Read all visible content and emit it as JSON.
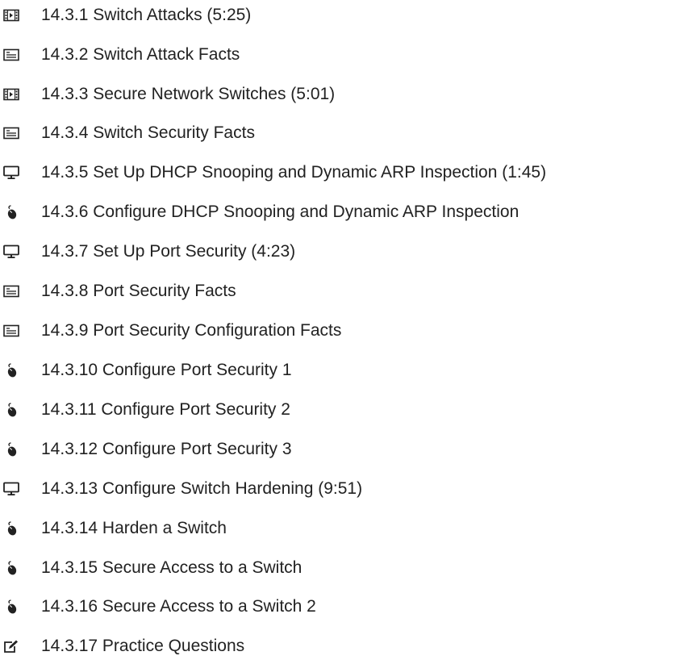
{
  "items": [
    {
      "icon": "video-icon",
      "label": "14.3.1 Switch Attacks (5:25)"
    },
    {
      "icon": "text-document-icon",
      "label": "14.3.2 Switch Attack Facts"
    },
    {
      "icon": "video-icon",
      "label": "14.3.3 Secure Network Switches (5:01)"
    },
    {
      "icon": "text-document-icon",
      "label": "14.3.4 Switch Security Facts"
    },
    {
      "icon": "monitor-icon",
      "label": "14.3.5 Set Up DHCP Snooping and Dynamic ARP Inspection (1:45)"
    },
    {
      "icon": "mouse-icon",
      "label": "14.3.6 Configure DHCP Snooping and Dynamic ARP Inspection"
    },
    {
      "icon": "monitor-icon",
      "label": "14.3.7 Set Up Port Security (4:23)"
    },
    {
      "icon": "text-document-icon",
      "label": "14.3.8 Port Security Facts"
    },
    {
      "icon": "text-document-icon",
      "label": "14.3.9 Port Security Configuration Facts"
    },
    {
      "icon": "mouse-icon",
      "label": "14.3.10 Configure Port Security 1"
    },
    {
      "icon": "mouse-icon",
      "label": "14.3.11 Configure Port Security 2"
    },
    {
      "icon": "mouse-icon",
      "label": "14.3.12 Configure Port Security 3"
    },
    {
      "icon": "monitor-icon",
      "label": "14.3.13 Configure Switch Hardening (9:51)"
    },
    {
      "icon": "mouse-icon",
      "label": "14.3.14 Harden a Switch"
    },
    {
      "icon": "mouse-icon",
      "label": "14.3.15 Secure Access to a Switch"
    },
    {
      "icon": "mouse-icon",
      "label": "14.3.16 Secure Access to a Switch 2"
    },
    {
      "icon": "edit-icon",
      "label": "14.3.17 Practice Questions"
    }
  ]
}
